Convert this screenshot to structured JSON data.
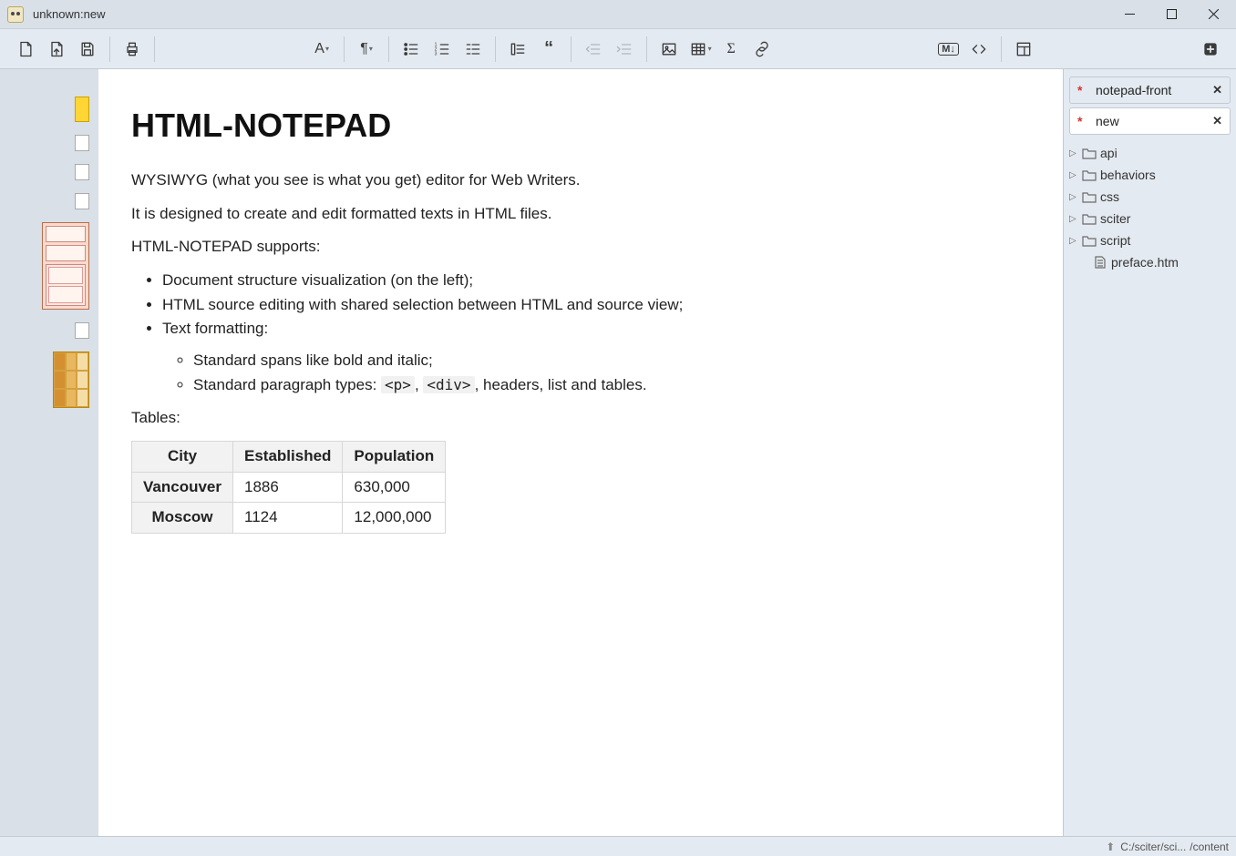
{
  "window": {
    "title": "unknown:new"
  },
  "tabs": [
    {
      "dirty": "*",
      "name": "notepad-front",
      "close": "✕"
    },
    {
      "dirty": "*",
      "name": "new",
      "close": "✕"
    }
  ],
  "tree": {
    "folders": [
      "api",
      "behaviors",
      "css",
      "sciter",
      "script"
    ],
    "files": [
      "preface.htm"
    ]
  },
  "statusbar": {
    "path_left": "C:/sciter/sci...",
    "path_right": "/content"
  },
  "doc": {
    "h1": "HTML-NOTEPAD",
    "p1": "WYSIWYG (what you see is what you get) editor for Web Writers.",
    "p2": "It is designed to create and edit formatted texts in HTML files.",
    "p3": "HTML-NOTEPAD supports:",
    "li1": "Document structure visualization (on the left);",
    "li2": "HTML source editing with shared selection between HTML and source view;",
    "li3": "Text formatting:",
    "li3a": "Standard spans like bold and italic;",
    "li3b_pre": "Standard paragraph types: ",
    "li3b_code1": "<p>",
    "li3b_mid": ", ",
    "li3b_code2": "<div>",
    "li3b_post": ", headers, list and tables.",
    "p4": "Tables:",
    "table": {
      "headers": [
        "City",
        "Established",
        "Population"
      ],
      "rows": [
        [
          "Vancouver",
          "1886",
          "630,000"
        ],
        [
          "Moscow",
          "1124",
          "12,000,000"
        ]
      ]
    }
  },
  "toolbar_text": {
    "font": "A",
    "markdown": "M↓"
  }
}
